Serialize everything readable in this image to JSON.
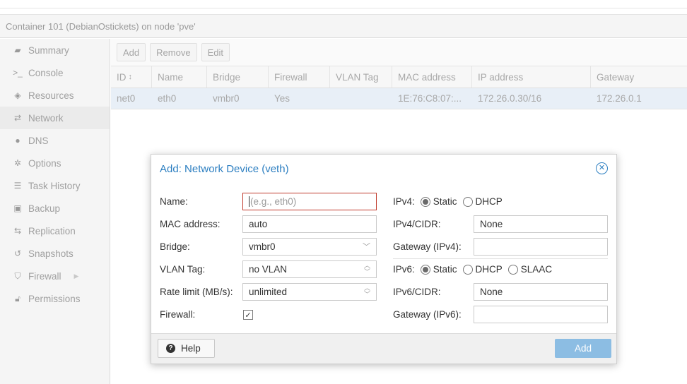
{
  "panel_title": "Container 101 (DebianOstickets) on node 'pve'",
  "sidebar": {
    "items": [
      {
        "label": "Summary",
        "icon": "book-icon"
      },
      {
        "label": "Console",
        "icon": "terminal-icon"
      },
      {
        "label": "Resources",
        "icon": "cube-icon"
      },
      {
        "label": "Network",
        "icon": "exchange-icon"
      },
      {
        "label": "DNS",
        "icon": "globe-icon"
      },
      {
        "label": "Options",
        "icon": "gear-icon"
      },
      {
        "label": "Task History",
        "icon": "list-icon"
      },
      {
        "label": "Backup",
        "icon": "floppy-icon"
      },
      {
        "label": "Replication",
        "icon": "retweet-icon"
      },
      {
        "label": "Snapshots",
        "icon": "history-icon"
      },
      {
        "label": "Firewall",
        "icon": "shield-icon"
      },
      {
        "label": "Permissions",
        "icon": "unlock-icon"
      }
    ],
    "active": "Network"
  },
  "toolbar": {
    "add": "Add",
    "remove": "Remove",
    "edit": "Edit"
  },
  "grid": {
    "columns": [
      "ID",
      "Name",
      "Bridge",
      "Firewall",
      "VLAN Tag",
      "MAC address",
      "IP address",
      "Gateway"
    ],
    "rows": [
      [
        "net0",
        "eth0",
        "vmbr0",
        "Yes",
        "",
        "1E:76:C8:07:...",
        "172.26.0.30/16",
        "172.26.0.1"
      ]
    ]
  },
  "dialog": {
    "title": "Add: Network Device (veth)",
    "left": {
      "name_label": "Name:",
      "name_placeholder": "(e.g., eth0)",
      "mac_label": "MAC address:",
      "mac_value": "auto",
      "bridge_label": "Bridge:",
      "bridge_value": "vmbr0",
      "vlan_label": "VLAN Tag:",
      "vlan_value": "no VLAN",
      "rate_label": "Rate limit (MB/s):",
      "rate_value": "unlimited",
      "firewall_label": "Firewall:",
      "firewall_checked": true
    },
    "right": {
      "ipv4_label": "IPv4:",
      "ipv4_static": "Static",
      "ipv4_dhcp": "DHCP",
      "ipv4_selected": "Static",
      "ipv4cidr_label": "IPv4/CIDR:",
      "ipv4cidr_value": "None",
      "gw4_label": "Gateway (IPv4):",
      "gw4_value": "",
      "ipv6_label": "IPv6:",
      "ipv6_static": "Static",
      "ipv6_dhcp": "DHCP",
      "ipv6_slaac": "SLAAC",
      "ipv6_selected": "Static",
      "ipv6cidr_label": "IPv6/CIDR:",
      "ipv6cidr_value": "None",
      "gw6_label": "Gateway (IPv6):",
      "gw6_value": ""
    },
    "help": "Help",
    "add": "Add"
  }
}
